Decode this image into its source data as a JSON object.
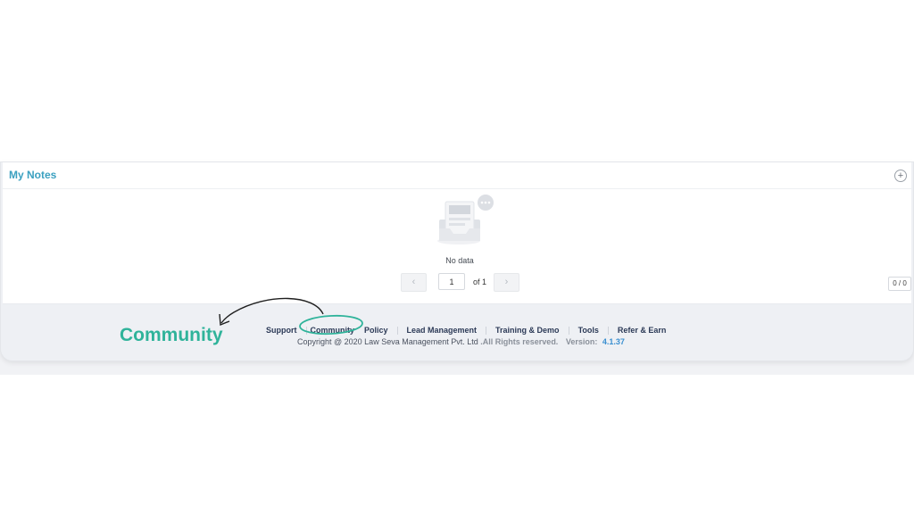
{
  "notes": {
    "title": "My Notes",
    "add_symbol": "+",
    "empty_text": "No data",
    "empty_icon": "empty-inbox-icon",
    "pager": {
      "prev_symbol": "‹",
      "next_symbol": "›",
      "current_page": "1",
      "of_text": "of 1"
    },
    "count": "0 / 0"
  },
  "footer": {
    "links": [
      "Support",
      "Community",
      "Policy",
      "Lead Management",
      "Training & Demo",
      "Tools",
      "Refer & Earn"
    ],
    "copyright": "Copyright @ 2020 Law Seva Management Pvt. Ltd",
    "rights": ".All Rights reserved.",
    "version_label": "Version:",
    "version": "4.1.37"
  },
  "annotation": {
    "label": "Community",
    "color": "#2fb39a"
  },
  "colors": {
    "accent_title": "#3aa0c0",
    "footer_link": "#2c3a57",
    "version": "#3a8fd0"
  }
}
